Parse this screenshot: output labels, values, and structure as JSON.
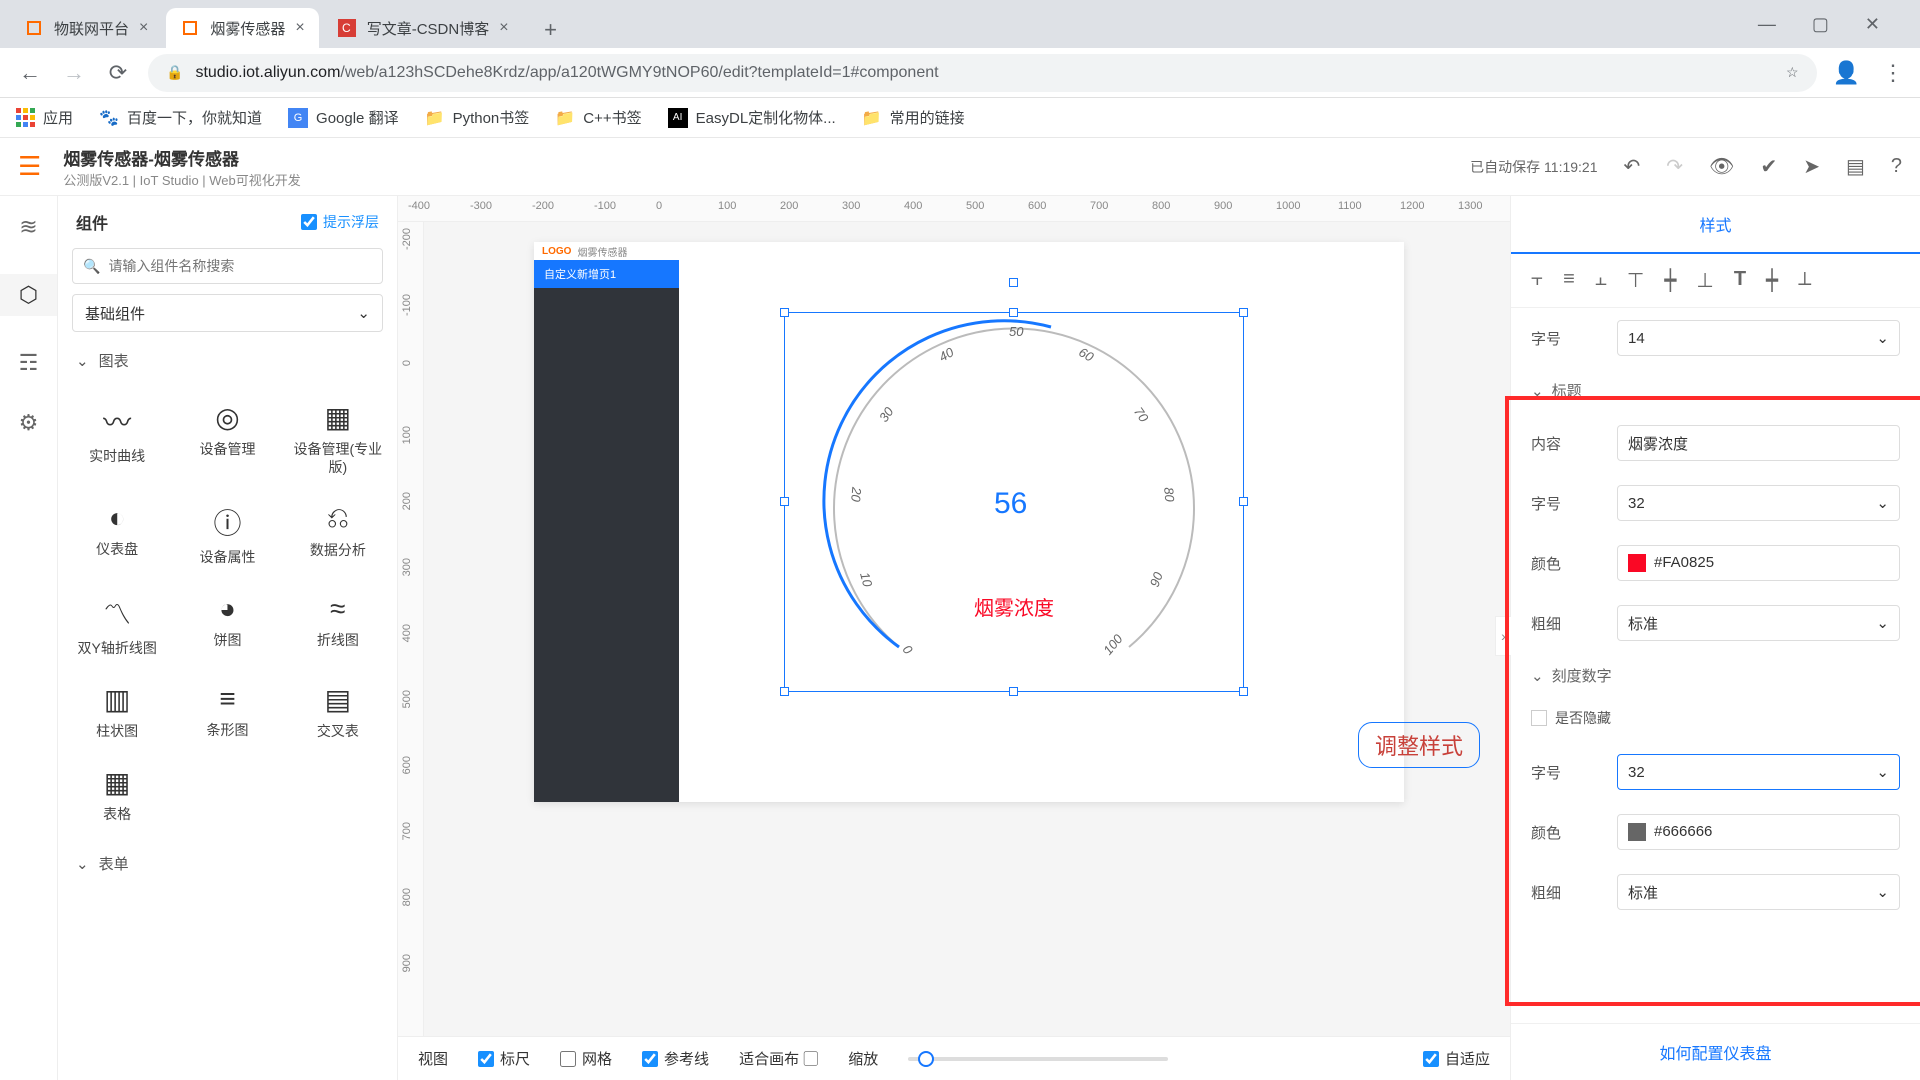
{
  "browser": {
    "tabs": [
      {
        "title": "物联网平台",
        "favicon_color": "#ff6a00"
      },
      {
        "title": "烟雾传感器",
        "favicon_color": "#ff6a00"
      },
      {
        "title": "写文章-CSDN博客",
        "favicon_color": "#d73d36"
      }
    ],
    "url_host": "studio.iot.aliyun.com",
    "url_path": "/web/a123hSCDehe8Krdz/app/a120tWGMY9tNOP60/edit?templateId=1#component",
    "bookmarks": {
      "apps": "应用",
      "items": [
        "百度一下，你就知道",
        "Google 翻译",
        "Python书签",
        "C++书签",
        "EasyDL定制化物体...",
        "常用的链接"
      ]
    }
  },
  "app": {
    "title": "烟雾传感器-烟雾传感器",
    "subtitle": "公测版V2.1 | IoT Studio | Web可视化开发",
    "autosave": "已自动保存 11:19:21"
  },
  "left_panel": {
    "heading": "组件",
    "hint_label": "提示浮层",
    "search_placeholder": "请输入组件名称搜索",
    "category": "基础组件",
    "section": "图表",
    "items": [
      "实时曲线",
      "设备管理",
      "设备管理(专业版)",
      "仪表盘",
      "设备属性",
      "数据分析",
      "双Y轴折线图",
      "饼图",
      "折线图",
      "柱状图",
      "条形图",
      "交叉表",
      "表格"
    ],
    "section2": "表单"
  },
  "canvas": {
    "page_logo": "LOGO",
    "page_title": "烟雾传感器",
    "menu_item": "自定义新增页1",
    "gauge_value": "56",
    "gauge_title": "烟雾浓度",
    "callout": "调整样式",
    "hruler": [
      "-400",
      "-300",
      "-200",
      "-100",
      "0",
      "100",
      "200",
      "300",
      "400",
      "500",
      "600",
      "700",
      "800",
      "900",
      "1000",
      "1100",
      "1200",
      "1300"
    ],
    "vruler": [
      "-200",
      "-100",
      "0",
      "100",
      "200",
      "300",
      "400",
      "500",
      "600",
      "700",
      "800",
      "900"
    ],
    "ticks": [
      "0",
      "10",
      "20",
      "30",
      "40",
      "50",
      "60",
      "70",
      "80",
      "90",
      "100"
    ]
  },
  "bottombar": {
    "view": "视图",
    "ruler": "标尺",
    "grid": "网格",
    "guide": "参考线",
    "fit": "适合画布",
    "zoom": "缩放",
    "responsive": "自适应"
  },
  "props": {
    "tab": "样式",
    "font_size_label": "字号",
    "font_size_value": "14",
    "section_title": "标题",
    "content_label": "内容",
    "content_value": "烟雾浓度",
    "title_font_label": "字号",
    "title_font_value": "32",
    "color_label": "颜色",
    "color_value": "#FA0825",
    "weight_label": "粗细",
    "weight_value": "标准",
    "section_scale": "刻度数字",
    "hide_label": "是否隐藏",
    "scale_font_label": "字号",
    "scale_font_value": "32",
    "scale_color_label": "颜色",
    "scale_color_value": "#666666",
    "scale_weight_label": "粗细",
    "scale_weight_value": "标准",
    "footer_link": "如何配置仪表盘"
  },
  "chart_data": {
    "type": "gauge",
    "title": "烟雾浓度",
    "value": 56,
    "min": 0,
    "max": 100,
    "ticks": [
      0,
      10,
      20,
      30,
      40,
      50,
      60,
      70,
      80,
      90,
      100
    ],
    "value_color": "#1677ff",
    "title_color": "#FA0825",
    "tick_color": "#666666"
  }
}
